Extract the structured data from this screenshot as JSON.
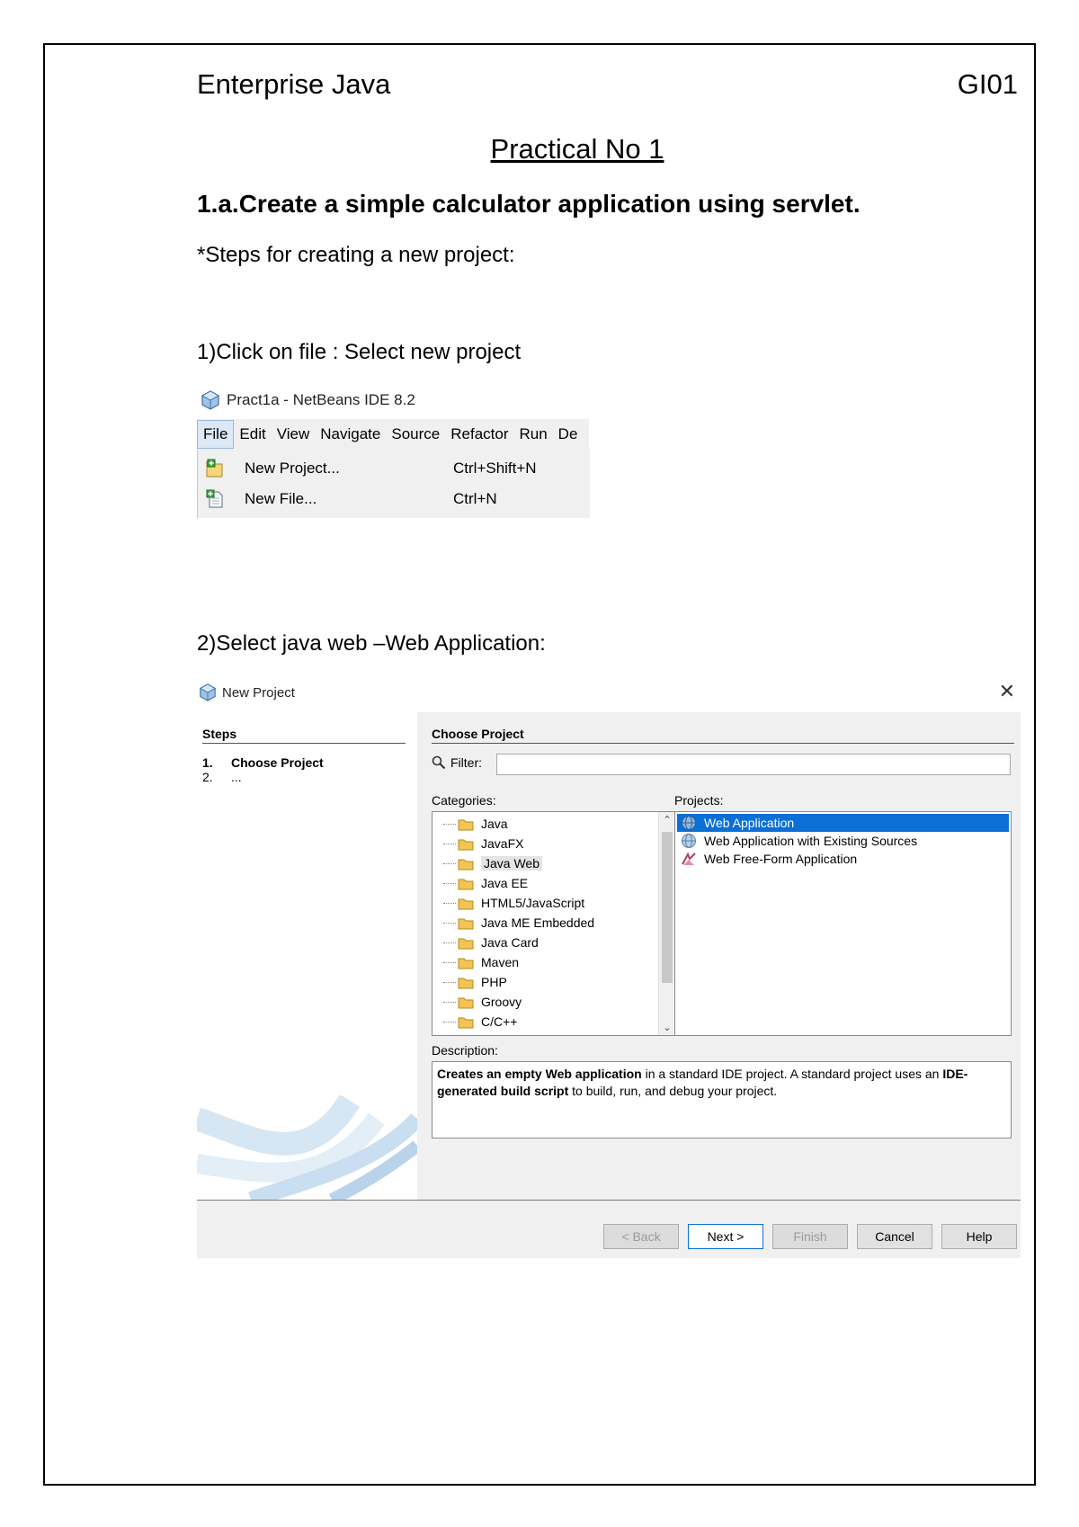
{
  "header": {
    "course": "Enterprise Java",
    "code": "GI01"
  },
  "practical_title": "Practical No 1",
  "aim": "1.a.Create a simple calculator application using servlet.",
  "steps_heading": "*Steps for creating a new project:",
  "step1_text": "1)Click on file : Select new project",
  "step2_text": "2)Select java web –Web Application:",
  "netbeans": {
    "window_title": "Pract1a - NetBeans IDE 8.2",
    "menus": [
      "File",
      "Edit",
      "View",
      "Navigate",
      "Source",
      "Refactor",
      "Run",
      "De"
    ],
    "file_menu": [
      {
        "label": "New Project...",
        "shortcut": "Ctrl+Shift+N",
        "icon": "new-project-icon"
      },
      {
        "label": "New File...",
        "shortcut": "Ctrl+N",
        "icon": "new-file-icon"
      }
    ]
  },
  "dialog": {
    "title": "New Project",
    "close": "✕",
    "steps_heading": "Steps",
    "steps": [
      {
        "num": "1.",
        "label": "Choose Project"
      },
      {
        "num": "2.",
        "label": "..."
      }
    ],
    "panel_heading": "Choose Project",
    "filter_label": "Filter:",
    "filter_value": "",
    "categories_label": "Categories:",
    "projects_label": "Projects:",
    "categories": [
      "Java",
      "JavaFX",
      "Java Web",
      "Java EE",
      "HTML5/JavaScript",
      "Java ME Embedded",
      "Java Card",
      "Maven",
      "PHP",
      "Groovy",
      "C/C++"
    ],
    "selected_category": "Java Web",
    "projects": [
      "Web Application",
      "Web Application with Existing Sources",
      "Web Free-Form Application"
    ],
    "selected_project": "Web Application",
    "description_label": "Description:",
    "description": {
      "bold1": "Creates an empty Web application",
      "text1": " in a standard IDE project. A standard project uses an ",
      "bold2": "IDE-generated build script",
      "text2": " to build, run, and debug your project."
    },
    "buttons": {
      "back": "< Back",
      "next": "Next >",
      "finish": "Finish",
      "cancel": "Cancel",
      "help": "Help"
    }
  }
}
